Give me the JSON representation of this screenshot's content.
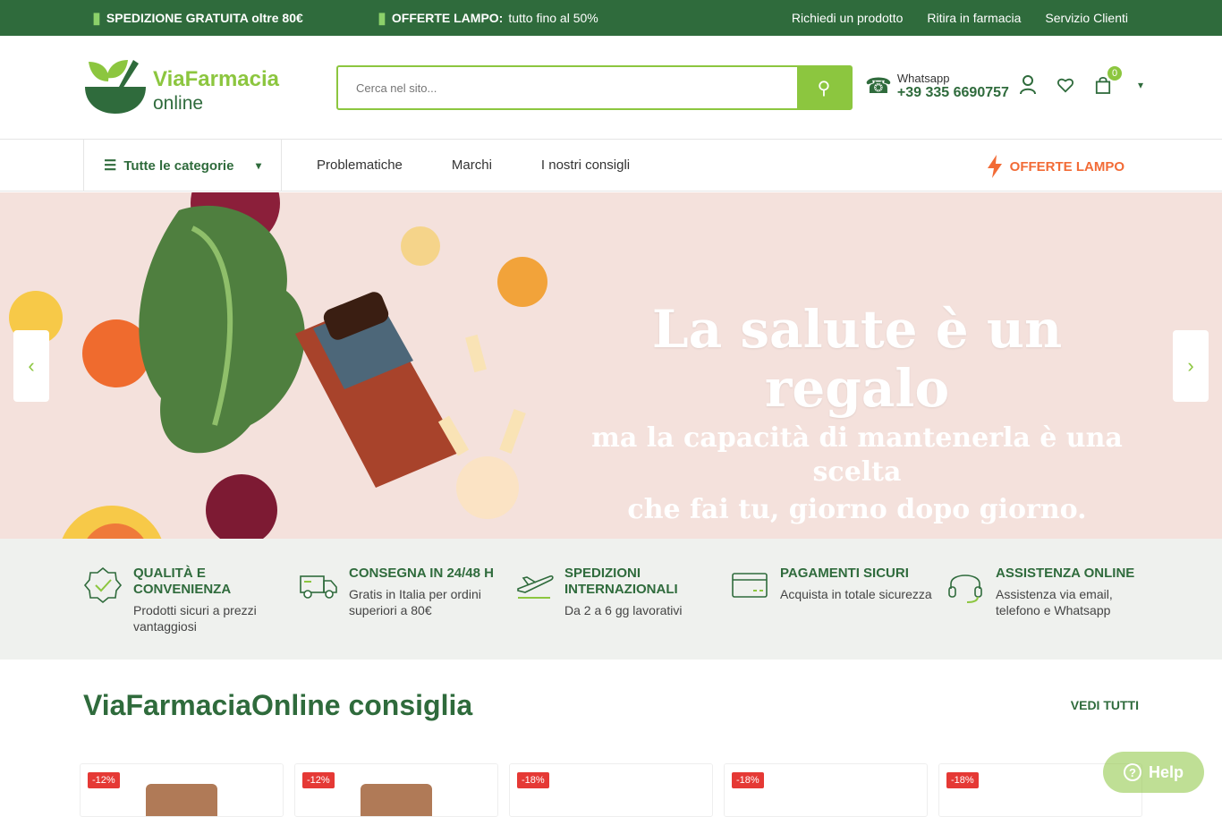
{
  "topbar": {
    "promo1_bold": "SPEDIZIONE GRATUITA oltre 80€",
    "promo2_bold": "OFFERTE LAMPO:",
    "promo2_text": "tutto fino al 50%",
    "links": [
      "Richiedi un prodotto",
      "Ritira in farmacia",
      "Servizio Clienti"
    ]
  },
  "header": {
    "logo_line1": "ViaFarmacia",
    "logo_line2": "online",
    "search_placeholder": "Cerca nel sito...",
    "whatsapp_label": "Whatsapp",
    "whatsapp_number": "+39 335 6690757",
    "cart_count": "0"
  },
  "nav": {
    "categories_label": "Tutte le categorie",
    "items": [
      "Problematiche",
      "Marchi",
      "I nostri consigli"
    ],
    "offerte_label": "OFFERTE LAMPO"
  },
  "hero": {
    "headline": "La salute è un regalo",
    "subline1": "ma la capacità di mantenerla è una scelta",
    "subline2": "che fai tu, giorno dopo giorno."
  },
  "features": [
    {
      "title": "QUALITÀ E CONVENIENZA",
      "desc": "Prodotti sicuri a prezzi vantaggiosi",
      "icon": "badge-check-icon"
    },
    {
      "title": "CONSEGNA IN 24/48 H",
      "desc": "Gratis in Italia per ordini superiori a 80€",
      "icon": "truck-icon"
    },
    {
      "title": "SPEDIZIONI INTERNAZIONALI",
      "desc": "Da 2 a 6 gg lavorativi",
      "icon": "plane-icon"
    },
    {
      "title": "PAGAMENTI SICURI",
      "desc": "Acquista in totale sicurezza",
      "icon": "credit-card-icon"
    },
    {
      "title": "ASSISTENZA ONLINE",
      "desc": "Assistenza via email, telefono e Whatsapp",
      "icon": "headset-icon"
    }
  ],
  "section": {
    "title": "ViaFarmaciaOnline consiglia",
    "view_all": "VEDI TUTTI"
  },
  "products": [
    {
      "discount": "-12%"
    },
    {
      "discount": "-12%"
    },
    {
      "discount": "-18%"
    },
    {
      "discount": "-18%"
    },
    {
      "discount": "-18%"
    }
  ],
  "help_label": "Help",
  "colors": {
    "primary": "#2f6b3c",
    "accent": "#8cc63f",
    "offer": "#f26b36",
    "discount": "#e53935"
  }
}
